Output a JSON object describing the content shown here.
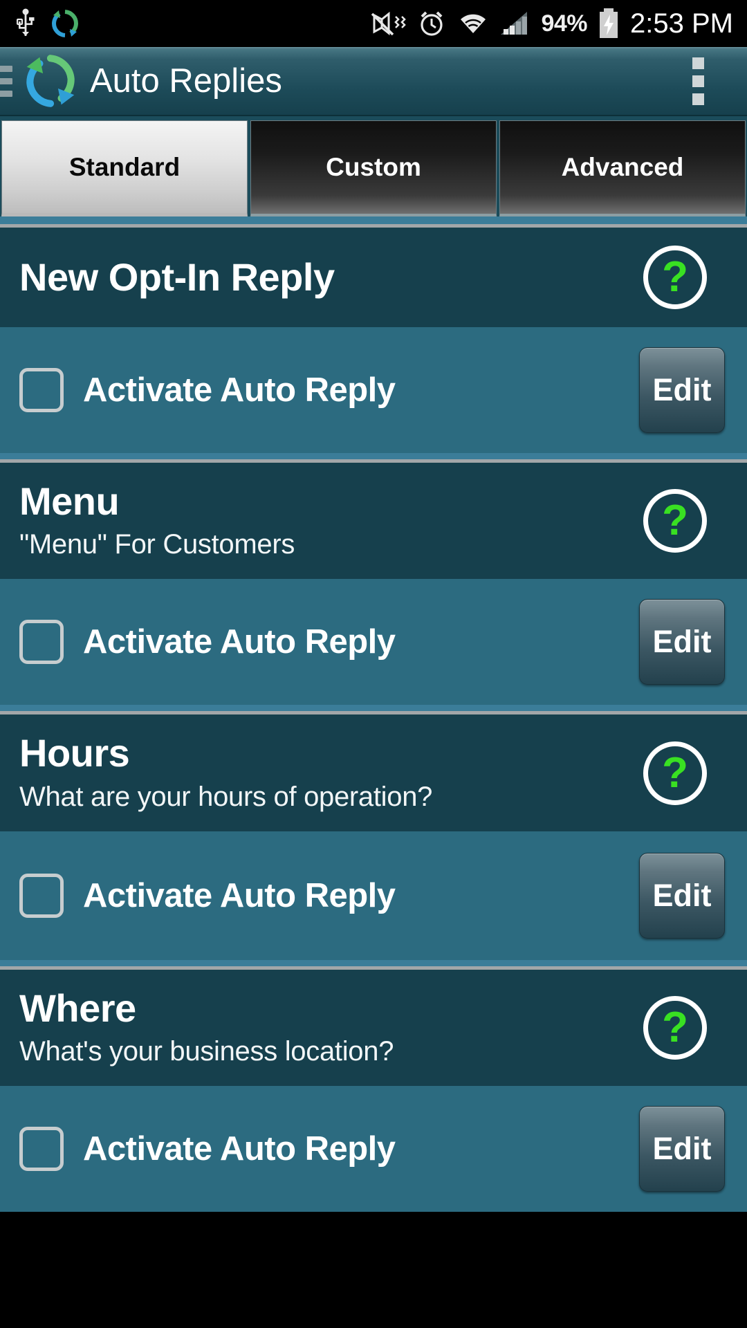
{
  "status_bar": {
    "icons": [
      "usb-icon",
      "sync-app-icon",
      "vibrate-off-icon",
      "alarm-icon",
      "wifi-icon",
      "signal-icon"
    ],
    "battery_percent": "94%",
    "battery_icon": "battery-charging-icon",
    "clock": "2:53 PM"
  },
  "action_bar": {
    "menu_icon": "hamburger-menu-icon",
    "logo_icon": "auto-reply-logo-icon",
    "title": "Auto Replies",
    "overflow_icon": "overflow-menu-icon"
  },
  "tabs": [
    {
      "label": "Standard",
      "selected": true
    },
    {
      "label": "Custom",
      "selected": false
    },
    {
      "label": "Advanced",
      "selected": false
    }
  ],
  "help_icon_glyph": "?",
  "cards": [
    {
      "title": "New Opt-In Reply",
      "subtitle": "",
      "help_label": "help-icon",
      "activate_label": "Activate Auto Reply",
      "activate_checked": false,
      "edit_label": "Edit"
    },
    {
      "title": "Menu",
      "subtitle": "\"Menu\" For Customers",
      "help_label": "help-icon",
      "activate_label": "Activate Auto Reply",
      "activate_checked": false,
      "edit_label": "Edit"
    },
    {
      "title": "Hours",
      "subtitle": "What are your hours of operation?",
      "help_label": "help-icon",
      "activate_label": "Activate Auto Reply",
      "activate_checked": false,
      "edit_label": "Edit"
    },
    {
      "title": "Where",
      "subtitle": "What's your business location?",
      "help_label": "help-icon",
      "activate_label": "Activate Auto Reply",
      "activate_checked": false,
      "edit_label": "Edit"
    }
  ],
  "colors": {
    "accent_green": "#39e022",
    "card_header_bg": "#16404d",
    "card_body_bg": "#2c6b80",
    "separator": "#3b7d99",
    "action_bar": "#1d4b59"
  }
}
